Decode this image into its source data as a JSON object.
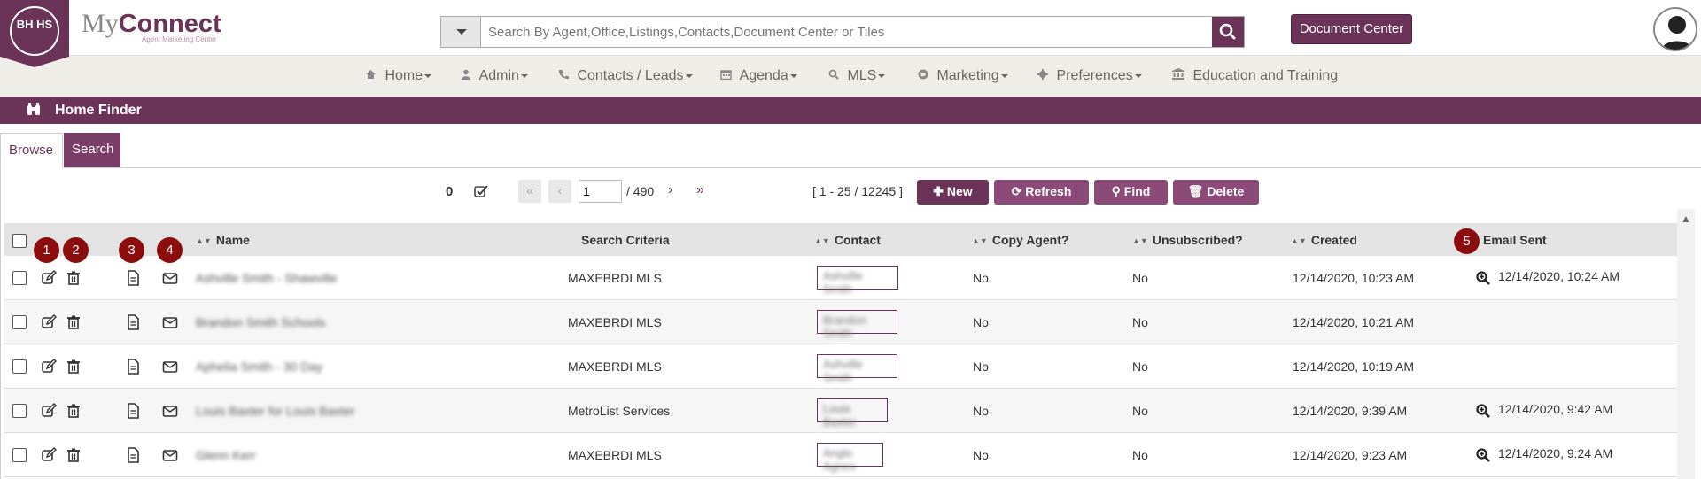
{
  "brand": {
    "logo_text": "BH HS",
    "name_prefix": "My",
    "name_main": "Connect",
    "tagline": "Agent Marketing Center"
  },
  "search": {
    "placeholder": "Search By Agent,Office,Listings,Contacts,Document Center or Tiles"
  },
  "header": {
    "document_center": "Document Center"
  },
  "nav": [
    {
      "label": "Home",
      "icon": "home-icon",
      "dropdown": true
    },
    {
      "label": "Admin",
      "icon": "user-icon",
      "dropdown": true
    },
    {
      "label": "Contacts / Leads",
      "icon": "phone-icon",
      "dropdown": true
    },
    {
      "label": "Agenda",
      "icon": "calendar-icon",
      "dropdown": true
    },
    {
      "label": "MLS",
      "icon": "search-icon",
      "dropdown": true
    },
    {
      "label": "Marketing",
      "icon": "globe-icon",
      "dropdown": true
    },
    {
      "label": "Preferences",
      "icon": "gear-icon",
      "dropdown": true
    },
    {
      "label": "Education and Training",
      "icon": "bank-icon",
      "dropdown": false
    }
  ],
  "page": {
    "title": "Home Finder"
  },
  "tabs": {
    "browse": "Browse",
    "search": "Search"
  },
  "pager": {
    "selected_count": "0",
    "page_value": "1",
    "page_total": "/ 490",
    "range": "[ 1 - 25 / 12245 ]"
  },
  "actions": {
    "new": "New",
    "refresh": "Refresh",
    "find": "Find",
    "delete": "Delete"
  },
  "badges": [
    "1",
    "2",
    "3",
    "4",
    "5"
  ],
  "columns": {
    "name": "Name",
    "criteria": "Search Criteria",
    "contact": "Contact",
    "copy_agent": "Copy Agent?",
    "unsubscribed": "Unsubscribed?",
    "created": "Created",
    "email_sent": "Email Sent"
  },
  "rows": [
    {
      "name": "Ashville Smith - Shawville",
      "criteria": "MAXEBRDI MLS",
      "contact": "Ashville Smith",
      "copy_agent": "No",
      "unsubscribed": "No",
      "created": "12/14/2020, 10:23 AM",
      "email_sent": "12/14/2020, 10:24 AM"
    },
    {
      "name": "Brandon Smith Schools",
      "criteria": "MAXEBRDI MLS",
      "contact": "Brandon Smith",
      "copy_agent": "No",
      "unsubscribed": "No",
      "created": "12/14/2020, 10:21 AM",
      "email_sent": ""
    },
    {
      "name": "Aphelia Smith - 30 Day",
      "criteria": "MAXEBRDI MLS",
      "contact": "Ashville Smith",
      "copy_agent": "No",
      "unsubscribed": "No",
      "created": "12/14/2020, 10:19 AM",
      "email_sent": ""
    },
    {
      "name": "Louis Baxter for Louis Baxter",
      "criteria": "MetroList Services",
      "contact": "Louis Baxter",
      "copy_agent": "No",
      "unsubscribed": "No",
      "created": "12/14/2020, 9:39 AM",
      "email_sent": "12/14/2020, 9:42 AM"
    },
    {
      "name": "Glenn Kerr",
      "criteria": "MAXEBRDI MLS",
      "contact": "Anglo Agnes",
      "copy_agent": "No",
      "unsubscribed": "No",
      "created": "12/14/2020, 9:23 AM",
      "email_sent": "12/14/2020, 9:24 AM"
    }
  ],
  "colors": {
    "brand": "#6b3358",
    "badge": "#8b0d0d"
  }
}
